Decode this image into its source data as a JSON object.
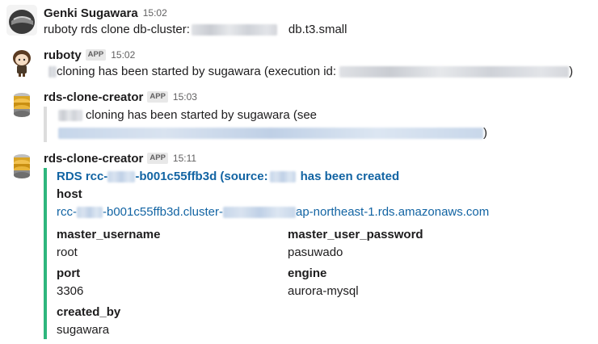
{
  "messages": [
    {
      "sender": "Genki Sugawara",
      "time": "15:02",
      "text_prefix": "ruboty rds clone db-cluster:",
      "text_suffix": "db.t3.small"
    },
    {
      "sender": "ruboty",
      "badge": "APP",
      "time": "15:02",
      "text_main": "cloning has been started by sugawara (execution id:",
      "text_close": ")"
    },
    {
      "sender": "rds-clone-creator",
      "badge": "APP",
      "time": "15:03",
      "text_main": "cloning has been started by sugawara (see",
      "text_close": ")"
    },
    {
      "sender": "rds-clone-creator",
      "badge": "APP",
      "time": "15:11",
      "attachment": {
        "title_a": "RDS rcc-",
        "title_b": "-b001c55ffb3d (source:",
        "title_c": "has been created",
        "host_label": "host",
        "host_a": "rcc-",
        "host_b": "-b001c55ffb3d.cluster-",
        "host_c": "ap-northeast-1.rds.amazonaws.com",
        "fields": [
          {
            "label": "master_username",
            "value": "root"
          },
          {
            "label": "master_user_password",
            "value": "pasuwado"
          },
          {
            "label": "port",
            "value": "3306"
          },
          {
            "label": "engine",
            "value": "aurora-mysql"
          },
          {
            "label": "created_by",
            "value": "sugawara"
          }
        ]
      }
    }
  ],
  "colors": {
    "attachment_bar": "#2eb67d",
    "link": "#1264a3",
    "quote_bar": "#dddddd"
  }
}
